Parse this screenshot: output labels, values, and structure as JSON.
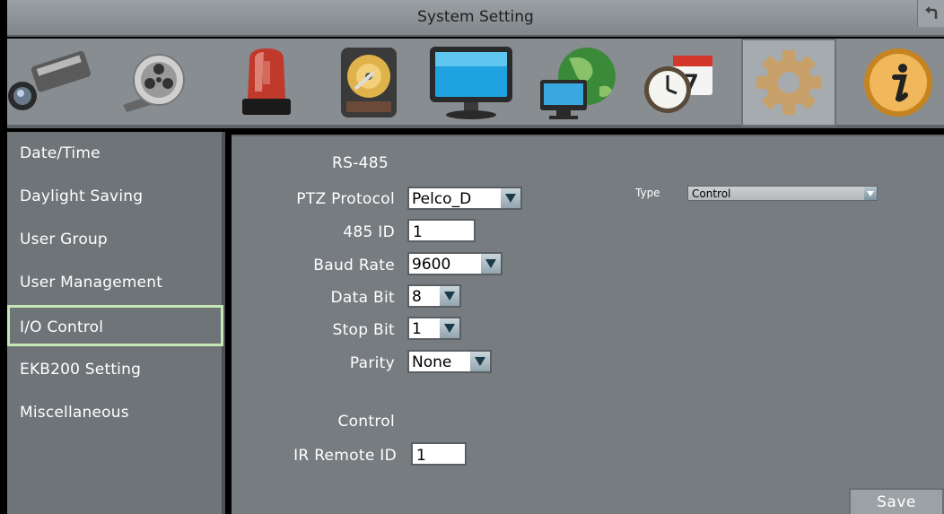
{
  "window": {
    "title": "System Setting"
  },
  "toolbar": {
    "icons": [
      "camera-icon",
      "film-reel-icon",
      "alarm-light-icon",
      "hard-drive-icon",
      "monitor-icon",
      "network-globe-icon",
      "schedule-clock-icon",
      "gear-icon",
      "info-icon"
    ],
    "active": "gear-icon"
  },
  "sidebar": {
    "items": [
      {
        "label": "Date/Time"
      },
      {
        "label": "Daylight Saving"
      },
      {
        "label": "User Group"
      },
      {
        "label": "User Management"
      },
      {
        "label": "I/O Control"
      },
      {
        "label": "EKB200 Setting"
      },
      {
        "label": "Miscellaneous"
      }
    ],
    "active_index": 4
  },
  "form": {
    "rs485_heading": "RS-485",
    "ptz_protocol": {
      "label": "PTZ Protocol",
      "value": "Pelco_D"
    },
    "id485": {
      "label": "485 ID",
      "value": "1"
    },
    "baud_rate": {
      "label": "Baud Rate",
      "value": "9600"
    },
    "data_bit": {
      "label": "Data Bit",
      "value": "8"
    },
    "stop_bit": {
      "label": "Stop Bit",
      "value": "1"
    },
    "parity": {
      "label": "Parity",
      "value": "None"
    },
    "type": {
      "label": "Type",
      "value": "Control"
    },
    "control_heading": "Control",
    "ir_remote_id": {
      "label": "IR Remote ID",
      "value": "1"
    },
    "save_label": "Save"
  },
  "colors": {
    "active_border": "#c6e8b7",
    "panel_bg": "#777c80",
    "sidebar_bg": "#6f7478"
  }
}
